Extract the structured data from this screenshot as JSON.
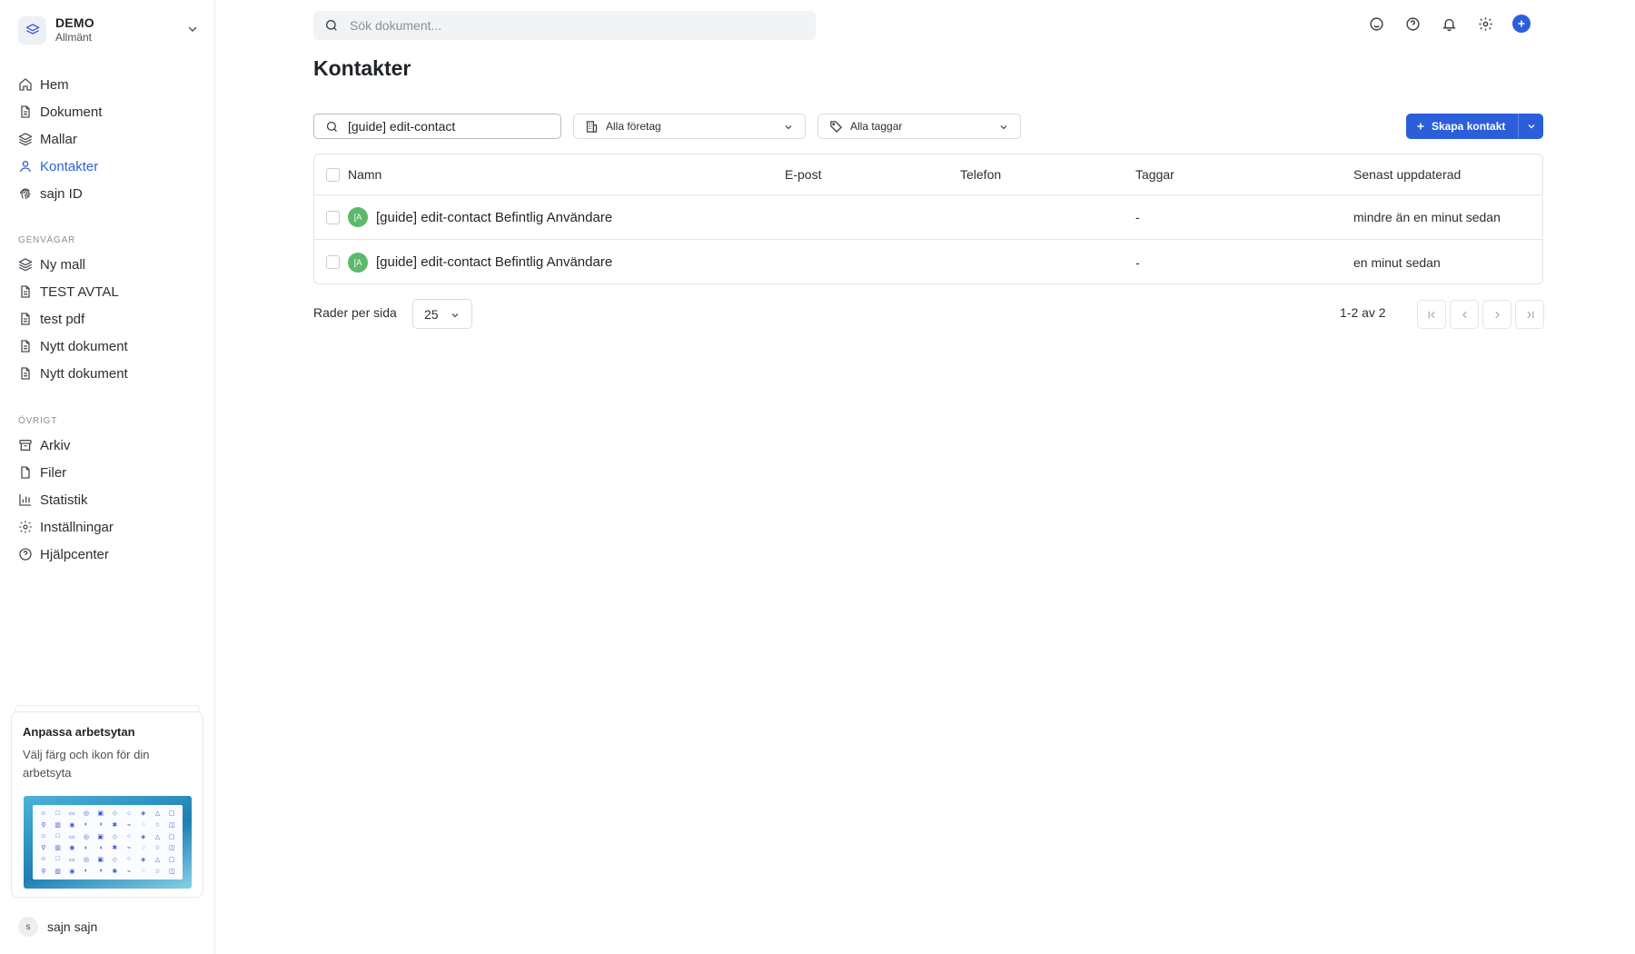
{
  "workspace": {
    "name": "DEMO",
    "subtitle": "Allmänt"
  },
  "nav": [
    {
      "label": "Hem",
      "icon": "home-icon"
    },
    {
      "label": "Dokument",
      "icon": "document-icon"
    },
    {
      "label": "Mallar",
      "icon": "layers-icon"
    },
    {
      "label": "Kontakter",
      "icon": "user-icon",
      "active": true
    },
    {
      "label": "sajn ID",
      "icon": "fingerprint-icon"
    }
  ],
  "shortcuts": {
    "heading": "GENVÄGAR",
    "items": [
      {
        "label": "Ny mall",
        "icon": "layers-icon"
      },
      {
        "label": "TEST AVTAL",
        "icon": "document-icon"
      },
      {
        "label": "test pdf",
        "icon": "document-icon"
      },
      {
        "label": "Nytt dokument",
        "icon": "document-icon"
      },
      {
        "label": "Nytt dokument",
        "icon": "document-icon"
      }
    ]
  },
  "other": {
    "heading": "ÖVRIGT",
    "items": [
      {
        "label": "Arkiv",
        "icon": "archive-icon"
      },
      {
        "label": "Filer",
        "icon": "file-icon"
      },
      {
        "label": "Statistik",
        "icon": "bar-chart-icon"
      },
      {
        "label": "Inställningar",
        "icon": "gear-icon"
      },
      {
        "label": "Hjälpcenter",
        "icon": "help-icon"
      }
    ]
  },
  "promo": {
    "title": "Anpassa arbetsytan",
    "description": "Välj färg och ikon för din arbetsyta"
  },
  "user": {
    "initial": "s",
    "name": "sajn sajn"
  },
  "top": {
    "search_placeholder": "Sök dokument..."
  },
  "page": {
    "title": "Kontakter"
  },
  "filters": {
    "search_value": "[guide] edit-contact",
    "company": "Alla företag",
    "tags": "Alla taggar",
    "create_label": "Skapa kontakt"
  },
  "table": {
    "columns": [
      "Namn",
      "E-post",
      "Telefon",
      "Taggar",
      "Senast uppdaterad"
    ],
    "rows": [
      {
        "initials": "[A",
        "name": "[guide] edit-contact Befintlig Användare",
        "email": "",
        "phone": "",
        "tags": "-",
        "updated": "mindre än en minut sedan"
      },
      {
        "initials": "[A",
        "name": "[guide] edit-contact Befintlig Användare",
        "email": "",
        "phone": "",
        "tags": "-",
        "updated": "en minut sedan"
      }
    ]
  },
  "pagination": {
    "rows_per_page_label": "Rader per sida",
    "rows_per_page": "25",
    "info": "1-2 av 2"
  },
  "colors": {
    "accent": "#2b5fd9",
    "avatar": "#5cb86a"
  }
}
